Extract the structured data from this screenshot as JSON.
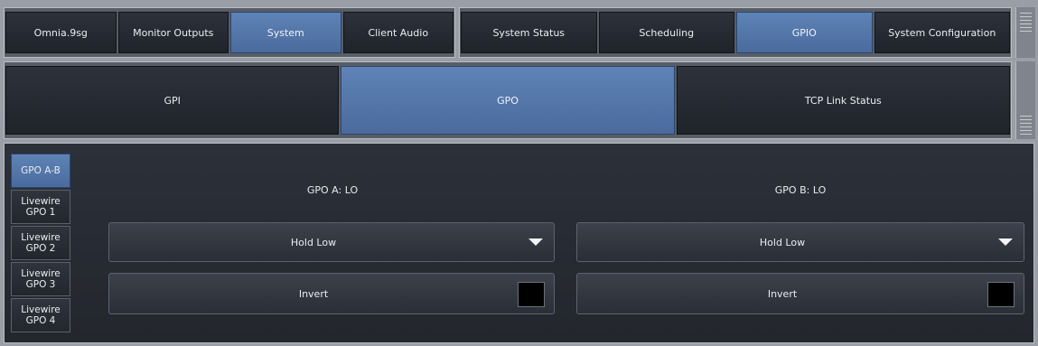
{
  "top_tabs_left": [
    {
      "label": "Omnia.9sg",
      "active": false
    },
    {
      "label": "Monitor Outputs",
      "active": false
    },
    {
      "label": "System",
      "active": true
    },
    {
      "label": "Client Audio",
      "active": false
    }
  ],
  "top_tabs_right": [
    {
      "label": "System Status",
      "active": false
    },
    {
      "label": "Scheduling",
      "active": false
    },
    {
      "label": "GPIO",
      "active": true
    },
    {
      "label": "System Configuration",
      "active": false
    }
  ],
  "sub_tabs": [
    {
      "label": "GPI",
      "active": false
    },
    {
      "label": "GPO",
      "active": true
    },
    {
      "label": "TCP Link Status",
      "active": false
    }
  ],
  "side_tabs": [
    {
      "label": "GPO A-B",
      "active": true
    },
    {
      "label": "Livewire\nGPO 1",
      "active": false
    },
    {
      "label": "Livewire\nGPO 2",
      "active": false
    },
    {
      "label": "Livewire\nGPO 3",
      "active": false
    },
    {
      "label": "Livewire\nGPO 4",
      "active": false
    }
  ],
  "gpo_a": {
    "status": "GPO A: LO",
    "mode_value": "Hold Low",
    "invert_label": "Invert"
  },
  "gpo_b": {
    "status": "GPO B: LO",
    "mode_value": "Hold Low",
    "invert_label": "Invert"
  },
  "colors": {
    "active_tab": "#5577aa",
    "inactive_tab": "#262a31",
    "panel_bg": "#2a2e36"
  }
}
